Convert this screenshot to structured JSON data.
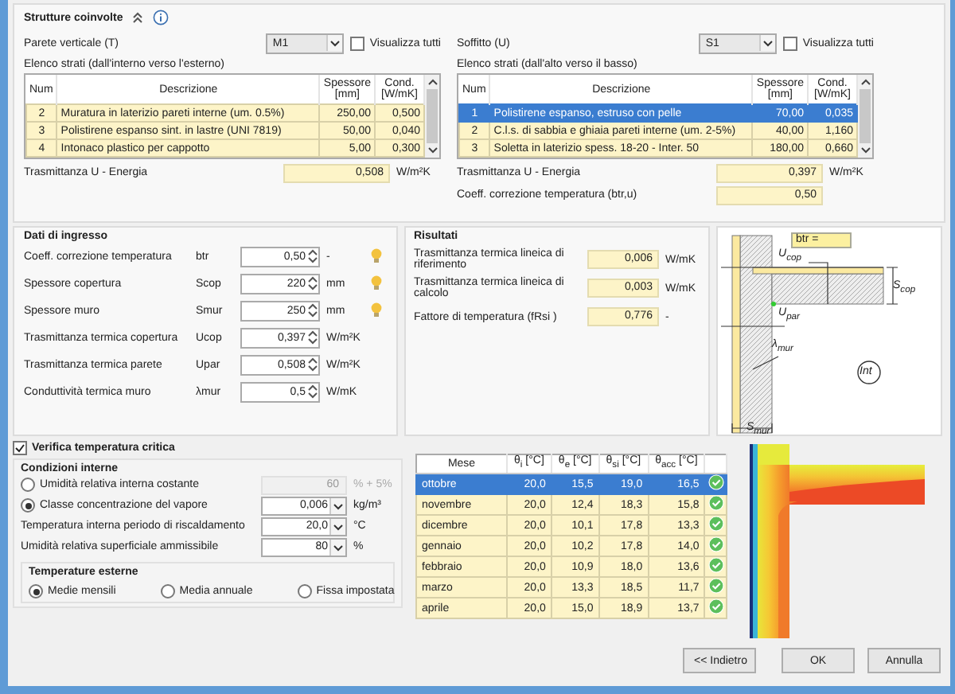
{
  "structures": {
    "title": "Strutture coinvolte"
  },
  "wall": {
    "label": "Parete verticale (T)",
    "combo": "M1",
    "show_all": {
      "label": "Visualizza tutti",
      "checked": false
    },
    "list_label": "Elenco strati (dall'interno verso l'esterno)",
    "columns": [
      "Num",
      "Descrizione",
      "Spessore [mm]",
      "Cond. [W/mK]"
    ],
    "rows": [
      {
        "num": "2",
        "description": "Muratura in laterizio pareti interne (um. 0.5%)",
        "thickness": "250,00",
        "cond": "0,500",
        "selected": false
      },
      {
        "num": "3",
        "description": "Polistirene espanso sint. in lastre (UNI 7819)",
        "thickness": "50,00",
        "cond": "0,040",
        "selected": false
      },
      {
        "num": "4",
        "description": "Intonaco plastico per cappotto",
        "thickness": "5,00",
        "cond": "0,300",
        "selected": false
      }
    ],
    "fields": [
      {
        "label": "Trasmittanza U - Energia",
        "value": "0,508",
        "unit": "W/m²K"
      }
    ]
  },
  "ceiling": {
    "label": "Soffitto (U)",
    "combo": "S1",
    "show_all": {
      "label": "Visualizza tutti",
      "checked": false
    },
    "list_label": "Elenco strati (dall'alto verso il basso)",
    "columns": [
      "Num",
      "Descrizione",
      "Spessore [mm]",
      "Cond. [W/mK]"
    ],
    "rows": [
      {
        "num": "1",
        "description": "Polistirene espanso, estruso con pelle",
        "thickness": "70,00",
        "cond": "0,035",
        "selected": true
      },
      {
        "num": "2",
        "description": "C.l.s. di sabbia e ghiaia pareti interne (um. 2-5%)",
        "thickness": "40,00",
        "cond": "1,160",
        "selected": false
      },
      {
        "num": "3",
        "description": "Soletta in laterizio spess. 18-20 - Inter. 50",
        "thickness": "180,00",
        "cond": "0,660",
        "selected": false
      }
    ],
    "fields": [
      {
        "label": "Trasmittanza U - Energia",
        "value": "0,397",
        "unit": "W/m²K"
      },
      {
        "label": "Coeff. correzione temperatura (btr,u)",
        "value": "0,50"
      }
    ]
  },
  "inputs": {
    "title": "Dati di ingresso",
    "rows": [
      {
        "label": "Coeff. correzione temperatura",
        "symbol": "btr",
        "value": "0,50",
        "unit": "-",
        "hint": true
      },
      {
        "label": "Spessore copertura",
        "symbol": "Scop",
        "value": "220",
        "unit": "mm",
        "hint": true
      },
      {
        "label": "Spessore muro",
        "symbol": "Smur",
        "value": "250",
        "unit": "mm",
        "hint": true
      },
      {
        "label": "Trasmittanza termica copertura",
        "symbol": "Ucop",
        "value": "0,397",
        "unit": "W/m²K",
        "hint": false
      },
      {
        "label": "Trasmittanza termica parete",
        "symbol": "Upar",
        "value": "0,508",
        "unit": "W/m²K",
        "hint": false
      },
      {
        "label": "Conduttività termica muro",
        "symbol": "λmur",
        "value": "0,5",
        "unit": "W/mK",
        "hint": false
      }
    ]
  },
  "results": {
    "title": "Risultati",
    "rows": [
      {
        "label": "Trasmittanza termica lineica di riferimento",
        "value": "0,006",
        "unit": "W/mK"
      },
      {
        "label": "Trasmittanza termica lineica di calcolo",
        "value": "0,003",
        "unit": "W/mK"
      },
      {
        "label": "Fattore di temperatura  (fRsi )",
        "value": "0,776",
        "unit": "-"
      }
    ]
  },
  "diagram": {
    "btr_label": "btr =",
    "labels": [
      "U$_{cop}$",
      "S$_{cop}$",
      "U$_{par}$",
      "λ$_{mur}$",
      "Int",
      "S$_{mur}$"
    ]
  },
  "critical_check": {
    "label": "Verifica temperatura critica",
    "checked": true
  },
  "internal_conditions": {
    "title": "Condizioni interne",
    "options": [
      {
        "label": "Umidità relativa interna costante",
        "selected": false,
        "value": "60",
        "unit": "% + 5%",
        "disabled": true
      },
      {
        "label": "Classe concentrazione del vapore",
        "selected": true,
        "value": "0,006",
        "unit": "kg/m³",
        "disabled": false
      }
    ],
    "fields": [
      {
        "label": "Temperatura interna periodo di riscaldamento",
        "value": "20,0",
        "unit": "°C"
      },
      {
        "label": "Umidità relativa superficiale ammissibile",
        "value": "80",
        "unit": "%"
      }
    ]
  },
  "external_temperatures": {
    "title": "Temperature esterne",
    "options": [
      {
        "label": "Medie mensili",
        "selected": true
      },
      {
        "label": "Media annuale",
        "selected": false
      },
      {
        "label": "Fissa impostata",
        "selected": false
      }
    ]
  },
  "months": {
    "columns": [
      "Mese",
      "θ$_{i}$ [°C]",
      "θ$_{e}$ [°C]",
      "θ$_{si}$ [°C]",
      "θ$_{acc}$ [°C]"
    ],
    "rows": [
      {
        "month": "ottobre",
        "ti": "20,0",
        "te": "15,5",
        "tsi": "19,0",
        "tacc": "16,5",
        "ok": true,
        "selected": true
      },
      {
        "month": "novembre",
        "ti": "20,0",
        "te": "12,4",
        "tsi": "18,3",
        "tacc": "15,8",
        "ok": true,
        "selected": false
      },
      {
        "month": "dicembre",
        "ti": "20,0",
        "te": "10,1",
        "tsi": "17,8",
        "tacc": "13,3",
        "ok": true,
        "selected": false
      },
      {
        "month": "gennaio",
        "ti": "20,0",
        "te": "10,2",
        "tsi": "17,8",
        "tacc": "14,0",
        "ok": true,
        "selected": false
      },
      {
        "month": "febbraio",
        "ti": "20,0",
        "te": "10,9",
        "tsi": "18,0",
        "tacc": "13,6",
        "ok": true,
        "selected": false
      },
      {
        "month": "marzo",
        "ti": "20,0",
        "te": "13,3",
        "tsi": "18,5",
        "tacc": "11,7",
        "ok": true,
        "selected": false
      },
      {
        "month": "aprile",
        "ti": "20,0",
        "te": "15,0",
        "tsi": "18,9",
        "tacc": "13,7",
        "ok": true,
        "selected": false
      }
    ]
  },
  "buttons": [
    "<< Indietro",
    "OK",
    "Annulla"
  ]
}
